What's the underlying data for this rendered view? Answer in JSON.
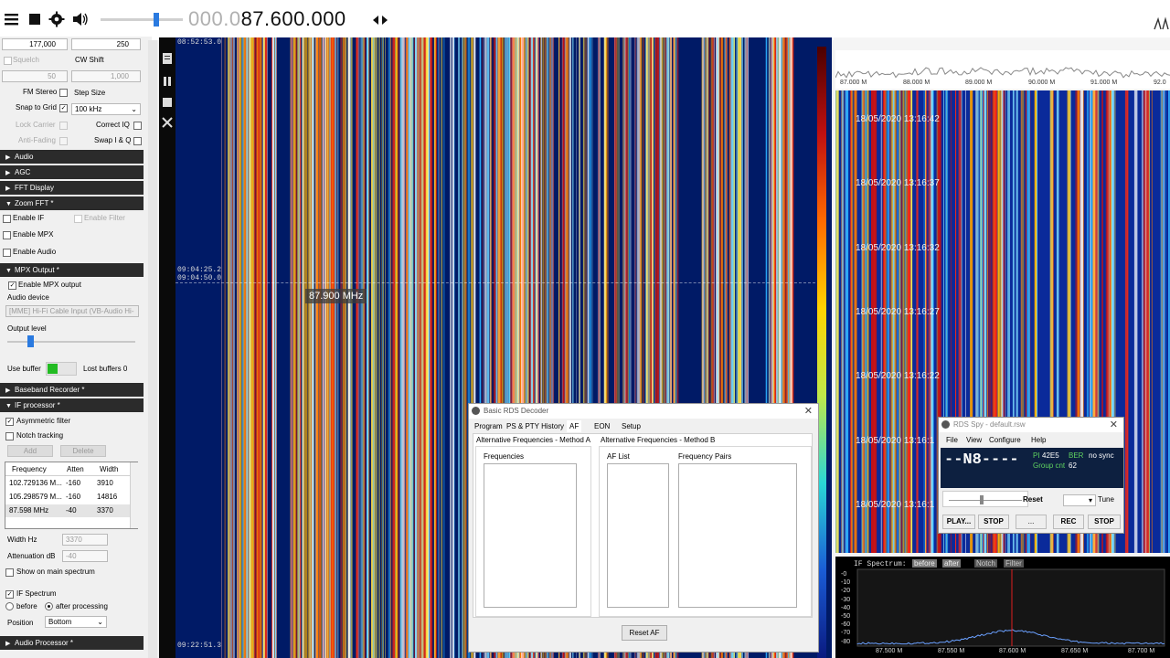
{
  "toolbar": {
    "freq_dim": "000.0",
    "freq_main": "87.600.000",
    "icons": [
      "menu-icon",
      "stop-icon",
      "gear-icon",
      "speaker-icon",
      "swap-arrows-icon"
    ]
  },
  "sidebar": {
    "field1": "177,000",
    "field2": "250",
    "squelch_label": "Squelch",
    "cwshift_label": "CW Shift",
    "squelch_val": "50",
    "cwshift_val": "1,000",
    "fm_stereo": "FM Stereo",
    "step_size": "Step Size",
    "snap_grid": "Snap to Grid",
    "step_value": "100 kHz",
    "lock_carrier": "Lock Carrier",
    "correct_iq": "Correct IQ",
    "anti_fading": "Anti-Fading",
    "swap_iq": "Swap I & Q",
    "sections": {
      "audio": "Audio",
      "agc": "AGC",
      "fft": "FFT Display",
      "zoom": "Zoom FFT *",
      "mpx": "MPX Output *",
      "baseband": "Baseband Recorder *",
      "ifproc": "IF processor *",
      "audioproc": "Audio Processor *"
    },
    "enable_if": "Enable IF",
    "enable_filter": "Enable Filter",
    "enable_mpx": "Enable MPX",
    "enable_audio": "Enable Audio",
    "enable_mpx_output": "Enable MPX output",
    "audio_device": "Audio device",
    "audio_device_value": "[MME] Hi-Fi Cable Input (VB-Audio Hi-",
    "output_level": "Output level",
    "use_buffer": "Use buffer",
    "lost_buffers": "Lost buffers 0",
    "asym_filter": "Asymmetric filter",
    "notch_tracking": "Notch tracking",
    "add": "Add",
    "delete": "Delete",
    "table_headers": [
      "Frequency",
      "Atten",
      "Width"
    ],
    "table_rows": [
      [
        "102.729136 M...",
        "-160",
        "3910"
      ],
      [
        "105.298579 M...",
        "-160",
        "14816"
      ],
      [
        "87.598 MHz",
        "-40",
        "3370"
      ]
    ],
    "width_hz": "Width Hz",
    "width_hz_val": "3370",
    "atten_db": "Attenuation dB",
    "atten_db_val": "-40",
    "show_main": "Show on main spectrum",
    "if_spectrum": "IF Spectrum",
    "before": "before",
    "after": "after processing",
    "position": "Position",
    "position_val": "Bottom"
  },
  "waterfall": {
    "ts_top": "08:52:53.0",
    "ts_mid1": "09:04:25.2",
    "ts_mid2": "09:04:50.0",
    "ts_bottom": "09:22:51.3",
    "cursor_freq": "87.900 MHz"
  },
  "right_panel": {
    "axis": [
      "87.000 M",
      "88.000 M",
      "89.000 M",
      "90.000 M",
      "91.000 M",
      "92.0"
    ],
    "timestamps": [
      "18/05/2020 13:16:42",
      "18/05/2020 13:16:37",
      "18/05/2020 13:16:32",
      "18/05/2020 13:16:27",
      "18/05/2020 13:16:22",
      "18/05/2020 13:16:1",
      "18/05/2020 13:16:1"
    ],
    "if_label": "IF Spectrum:",
    "if_tabs": [
      "before",
      "after",
      "Notch",
      "Filter"
    ],
    "if_yticks": [
      "-0",
      "-10",
      "-20",
      "-30",
      "-40",
      "-50",
      "-60",
      "-70",
      "-80"
    ],
    "if_xticks": [
      "87.500 M",
      "87.550 M",
      "87.600 M",
      "87.650 M",
      "87.700 M"
    ]
  },
  "rds_decoder": {
    "title": "Basic RDS Decoder",
    "tabs": [
      "Program",
      "PS & PTY History",
      "AF",
      "EON",
      "Setup"
    ],
    "method_a": "Alternative Frequencies - Method A",
    "method_b": "Alternative Frequencies - Method B",
    "frequencies": "Frequencies",
    "af_list": "AF List",
    "freq_pairs": "Frequency Pairs",
    "reset_af": "Reset AF"
  },
  "rds_spy": {
    "title": "RDS Spy - default.rsw",
    "menu": [
      "File",
      "View",
      "Configure",
      "Help"
    ],
    "ps": "--N8----",
    "pi_label": "PI",
    "pi": "42E5",
    "ber": "BER",
    "sync": "no sync",
    "group_cnt_label": "Group cnt",
    "group_cnt": "62",
    "reset": "Reset",
    "tune": "Tune",
    "play": "PLAY...",
    "stop1": "STOP",
    "dots": "...",
    "rec": "REC",
    "stop2": "STOP"
  },
  "colors": {
    "header_bg": "#2b2b2b",
    "waterfall_bg": "#001a66",
    "accent_red": "#e02020"
  }
}
